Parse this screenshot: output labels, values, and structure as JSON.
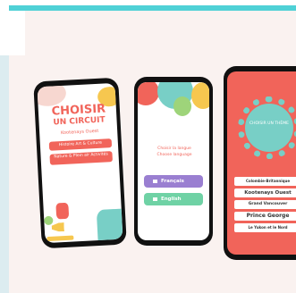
{
  "phone1": {
    "title": "CHOISIR",
    "subtitle": "UN CIRCUIT",
    "region": "Kootenays Ouest",
    "button1": "Histoire Art & Culture",
    "button2": "Nature & Plein air Activités"
  },
  "phone2": {
    "prompt_fr": "Choisir la langue",
    "prompt_en": "Choose language",
    "lang_fr": "Français",
    "lang_en": "English"
  },
  "phone3": {
    "circle_text": "CHOISIR UN THÈME",
    "list": [
      "Colombie-Britannique",
      "Kootenays Ouest",
      "Grand Vancouver",
      "Prince George",
      "Le Yukon et le Nord"
    ]
  },
  "colors": {
    "accent_red": "#f1645a",
    "teal": "#78cfc6",
    "purple": "#9a7fd1",
    "green": "#6fd2a5",
    "yellow": "#f6c74f"
  }
}
